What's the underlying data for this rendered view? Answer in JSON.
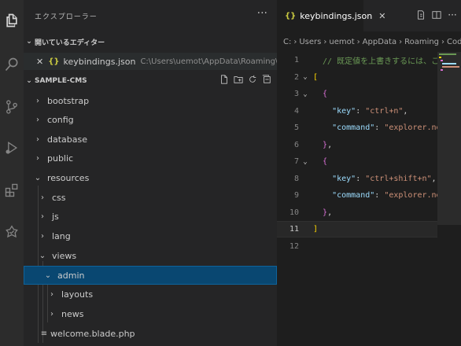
{
  "activity_bar": {
    "items": [
      {
        "icon": "files-icon"
      },
      {
        "icon": "search-icon"
      },
      {
        "icon": "source-control-icon"
      },
      {
        "icon": "run-debug-icon"
      },
      {
        "icon": "extensions-icon"
      },
      {
        "icon": "testing-icon"
      }
    ]
  },
  "sidebar": {
    "title": "エクスプローラー",
    "more": "···",
    "open_editors": {
      "label": "開いているエディター",
      "items": [
        {
          "close": "✕",
          "icon": "{}",
          "name": "keybindings.json",
          "path": "C:\\Users\\uemot\\AppData\\Roaming\\Code\\User"
        }
      ]
    },
    "project": {
      "label": "SAMPLE-CMS",
      "tree": [
        {
          "label": "bootstrap",
          "twisty": "›",
          "level": 1
        },
        {
          "label": "config",
          "twisty": "›",
          "level": 1
        },
        {
          "label": "database",
          "twisty": "›",
          "level": 1
        },
        {
          "label": "public",
          "twisty": "›",
          "level": 1
        },
        {
          "label": "resources",
          "twisty": "⌄",
          "level": 1
        },
        {
          "label": "css",
          "twisty": "›",
          "level": 2
        },
        {
          "label": "js",
          "twisty": "›",
          "level": 2
        },
        {
          "label": "lang",
          "twisty": "›",
          "level": 2
        },
        {
          "label": "views",
          "twisty": "⌄",
          "level": 2
        },
        {
          "label": "admin",
          "twisty": "⌄",
          "level": 2,
          "selected": true
        },
        {
          "label": "layouts",
          "twisty": "›",
          "level": 3
        },
        {
          "label": "news",
          "twisty": "›",
          "level": 3
        },
        {
          "label": "welcome.blade.php",
          "twisty": "≡",
          "level": 2
        }
      ]
    }
  },
  "editor": {
    "tab": {
      "icon": "{}",
      "name": "keybindings.json",
      "close": "✕"
    },
    "breadcrumb": [
      "C:",
      "Users",
      "uemot",
      "AppData",
      "Roaming",
      "Code",
      "Us"
    ],
    "current_line": 11,
    "lines": [
      {
        "n": "1",
        "fold": "",
        "tokens": [
          {
            "t": "  // 既定値を上書きするには、このフ",
            "c": "c-comment"
          }
        ]
      },
      {
        "n": "2",
        "fold": "⌄",
        "tokens": [
          {
            "t": "[",
            "c": "c-brace"
          }
        ]
      },
      {
        "n": "3",
        "fold": "⌄",
        "tokens": [
          {
            "t": "  {",
            "c": "c-brace2"
          }
        ]
      },
      {
        "n": "4",
        "fold": "",
        "tokens": [
          {
            "t": "    \"key\"",
            "c": "c-key"
          },
          {
            "t": ": ",
            "c": "c-punc"
          },
          {
            "t": "\"ctrl+n\"",
            "c": "c-str"
          },
          {
            "t": ",",
            "c": "c-punc"
          }
        ]
      },
      {
        "n": "5",
        "fold": "",
        "tokens": [
          {
            "t": "    \"command\"",
            "c": "c-key"
          },
          {
            "t": ": ",
            "c": "c-punc"
          },
          {
            "t": "\"explorer.newF",
            "c": "c-str"
          }
        ]
      },
      {
        "n": "6",
        "fold": "",
        "tokens": [
          {
            "t": "  }",
            "c": "c-brace2"
          },
          {
            "t": ",",
            "c": "c-punc"
          }
        ]
      },
      {
        "n": "7",
        "fold": "⌄",
        "tokens": [
          {
            "t": "  {",
            "c": "c-brace2"
          }
        ]
      },
      {
        "n": "8",
        "fold": "",
        "tokens": [
          {
            "t": "    \"key\"",
            "c": "c-key"
          },
          {
            "t": ": ",
            "c": "c-punc"
          },
          {
            "t": "\"ctrl+shift+n\"",
            "c": "c-str"
          },
          {
            "t": ",",
            "c": "c-punc"
          }
        ]
      },
      {
        "n": "9",
        "fold": "",
        "tokens": [
          {
            "t": "    \"command\"",
            "c": "c-key"
          },
          {
            "t": ": ",
            "c": "c-punc"
          },
          {
            "t": "\"explorer.newF",
            "c": "c-str"
          }
        ]
      },
      {
        "n": "10",
        "fold": "",
        "tokens": [
          {
            "t": "  }",
            "c": "c-brace2"
          },
          {
            "t": ",",
            "c": "c-punc"
          }
        ]
      },
      {
        "n": "11",
        "fold": "",
        "tokens": [
          {
            "t": "]",
            "c": "c-brace"
          }
        ]
      },
      {
        "n": "12",
        "fold": "",
        "tokens": []
      }
    ]
  },
  "colors": {
    "accent": "#0e639c",
    "selection": "#094771",
    "json_icon": "#cbcb41"
  }
}
